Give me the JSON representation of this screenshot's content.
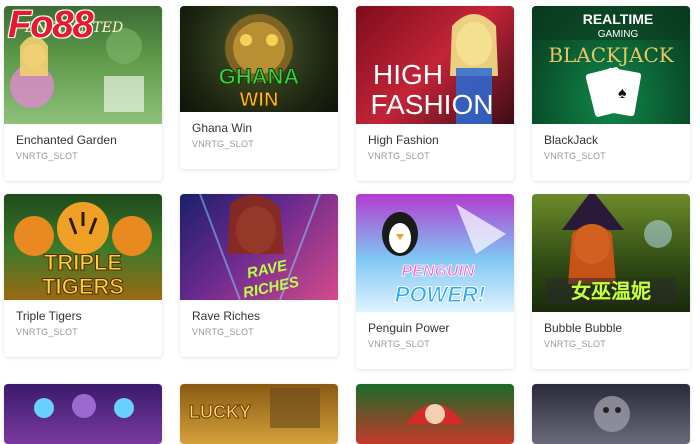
{
  "brand": {
    "logo_text": "Fo88"
  },
  "games": [
    {
      "title": "Enchanted Garden",
      "provider": "VNRTG_SLOT"
    },
    {
      "title": "Ghana Win",
      "provider": "VNRTG_SLOT"
    },
    {
      "title": "High Fashion",
      "provider": "VNRTG_SLOT"
    },
    {
      "title": "BlackJack",
      "provider": "VNRTG_SLOT"
    },
    {
      "title": "Triple Tigers",
      "provider": "VNRTG_SLOT"
    },
    {
      "title": "Rave Riches",
      "provider": "VNRTG_SLOT"
    },
    {
      "title": "Penguin Power",
      "provider": "VNRTG_SLOT"
    },
    {
      "title": "Bubble Bubble",
      "provider": "VNRTG_SLOT"
    }
  ],
  "artwork": {
    "enchanted": "ENCHANTED",
    "ghana_1": "GHANA",
    "ghana_2": "WIN",
    "fashion_1": "HIGH",
    "fashion_2": "FASHION",
    "rtg_1": "REALTIME",
    "rtg_2": "GAMING",
    "blackjack": "BLACKJACK",
    "tigers_1": "TRIPLE",
    "tigers_2": "TIGERS",
    "rave_1": "RAVE",
    "rave_2": "RICHES",
    "penguin_1": "PENGUIN",
    "penguin_2": "POWER!",
    "bubble": "女巫温妮",
    "row3b": "LUCKY"
  }
}
